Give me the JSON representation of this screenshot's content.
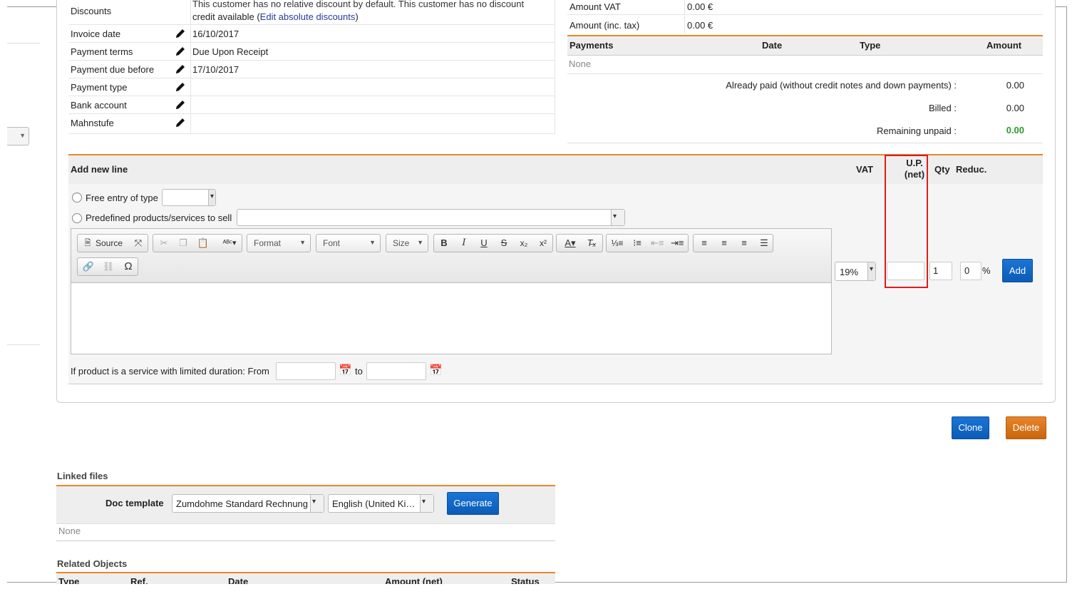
{
  "info": {
    "discounts_label": "Discounts",
    "discounts_text_line1": "This customer has no relative discount by default. This customer has no discount",
    "discounts_text_line2": "credit available",
    "discounts_link": "Edit absolute discounts",
    "rows": [
      {
        "label": "Invoice date",
        "value": "16/10/2017"
      },
      {
        "label": "Payment terms",
        "value": "Due Upon Receipt"
      },
      {
        "label": "Payment due before",
        "value": "17/10/2017"
      },
      {
        "label": "Payment type",
        "value": ""
      },
      {
        "label": "Bank account",
        "value": ""
      },
      {
        "label": "Mahnstufe",
        "value": ""
      }
    ]
  },
  "amounts": {
    "vat_label": "Amount VAT",
    "vat_value": "0.00 €",
    "inc_tax_label": "Amount (inc. tax)",
    "inc_tax_value": "0.00 €"
  },
  "payments": {
    "col_payments": "Payments",
    "col_date": "Date",
    "col_type": "Type",
    "col_amount": "Amount",
    "empty": "None",
    "already_paid_label": "Already paid (without credit notes and down payments) :",
    "already_paid_value": "0.00",
    "billed_label": "Billed :",
    "billed_value": "0.00",
    "remaining_label": "Remaining unpaid :",
    "remaining_value": "0.00"
  },
  "addline": {
    "title": "Add new line",
    "col_vat": "VAT",
    "col_up_1": "U.P.",
    "col_up_2": "(net)",
    "col_qty": "Qty",
    "col_reduc": "Reduc.",
    "free_entry_label": "Free entry of type",
    "predefined_label": "Predefined products/services to sell",
    "vat_value": "19%",
    "up_value": "",
    "qty_value": "1",
    "reduc_value": "0",
    "percent": "%",
    "add_button": "Add",
    "service_label": "If product is a service with limited duration: From",
    "to_label": "to"
  },
  "editor": {
    "source": "Source",
    "format": "Format",
    "font": "Font",
    "size": "Size"
  },
  "actions": {
    "clone": "Clone",
    "delete": "Delete"
  },
  "linked_files": {
    "title": "Linked files",
    "doc_template_label": "Doc template",
    "template_value": "Zumdohme Standard Rechnung",
    "language_value": "English (United Ki…",
    "generate": "Generate",
    "empty": "None"
  },
  "related": {
    "title": "Related Objects",
    "cols": [
      "Type",
      "Ref.",
      "Date",
      "Amount (net)",
      "Status"
    ]
  },
  "colors": {
    "accent_orange": "#e8882c",
    "button_blue": "#0b5cb5",
    "positive_green": "#2a9a2a",
    "highlight_red": "#e01b1b"
  }
}
